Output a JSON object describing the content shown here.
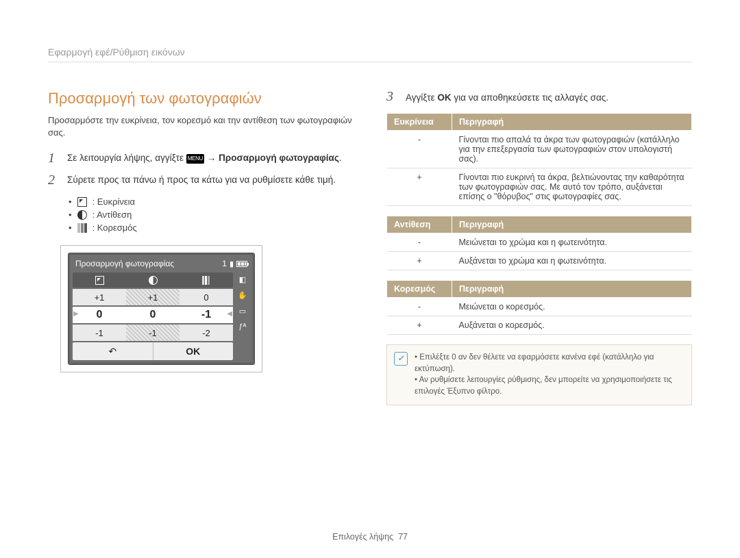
{
  "breadcrumb": "Εφαρμογή εφέ/Ρύθμιση εικόνων",
  "title": "Προσαρμογή των φωτογραφιών",
  "intro": "Προσαρμόστε την ευκρίνεια, τον κορεσμό και την αντίθεση των φωτογραφιών σας.",
  "steps": {
    "s1_num": "1",
    "s1_a": "Σε λειτουργία λήψης, αγγίξτε ",
    "s1_menu": "MENU",
    "s1_b": " → ",
    "s1_c": "Προσαρμογή φωτογραφίας",
    "s1_d": ".",
    "s2_num": "2",
    "s2": "Σύρετε προς τα πάνω ή προς τα κάτω για να ρυθμίσετε κάθε τιμή.",
    "bullets": {
      "b1": ": Ευκρίνεια",
      "b2": ": Αντίθεση",
      "b3": ": Κορεσμός"
    },
    "s3_num": "3",
    "s3_a": "Αγγίξτε ",
    "s3_ok": "OK",
    "s3_b": " για να αποθηκεύσετε τις αλλαγές σας."
  },
  "lcd": {
    "title": "Προσαρμογή φωτογραφίας",
    "count": "1",
    "row_plus": {
      "c1": "+1",
      "c2": "+1",
      "c3": "0"
    },
    "row_sel": {
      "c1": "0",
      "c2": "0",
      "c3": "-1"
    },
    "row_minus": {
      "c1": "-1",
      "c2": "-1",
      "c3": "-2"
    },
    "back": "↶",
    "ok": "OK",
    "side_exposure": "☀",
    "side_hand": "✋",
    "side_card": "▭",
    "side_flash": "ƒᴬ"
  },
  "tables": {
    "t1_h1": "Ευκρίνεια",
    "t1_h2": "Περιγραφή",
    "t1_r1_k": "-",
    "t1_r1_v": "Γίνονται πιο απαλά τα άκρα των φωτογραφιών (κατάλληλο για την επεξεργασία των φωτογραφιών στον υπολογιστή σας).",
    "t1_r2_k": "+",
    "t1_r2_v": "Γίνονται πιο ευκρινή τα άκρα, βελτιώνοντας την καθαρότητα των φωτογραφιών σας. Με αυτό τον τρόπο, αυξάνεται επίσης ο \"θόρυβος\" στις φωτογραφίες σας.",
    "t2_h1": "Αντίθεση",
    "t2_h2": "Περιγραφή",
    "t2_r1_k": "-",
    "t2_r1_v": "Μειώνεται το χρώμα και η φωτεινότητα.",
    "t2_r2_k": "+",
    "t2_r2_v": "Αυξάνεται το χρώμα και η φωτεινότητα.",
    "t3_h1": "Κορεσμός",
    "t3_h2": "Περιγραφή",
    "t3_r1_k": "-",
    "t3_r1_v": "Μειώνεται ο κορεσμός.",
    "t3_r2_k": "+",
    "t3_r2_v": "Αυξάνεται ο κορεσμός."
  },
  "note": {
    "n1": "Επιλέξτε 0 αν δεν θέλετε να εφαρμόσετε κανένα εφέ (κατάλληλο για εκτύπωση).",
    "n2": "Αν ρυθμίσετε λειτουργίες ρύθμισης, δεν μπορείτε να χρησιμοποιήσετε τις επιλογές Έξυπνο φίλτρο."
  },
  "footer": {
    "section": "Επιλογές λήψης",
    "page": "77"
  }
}
